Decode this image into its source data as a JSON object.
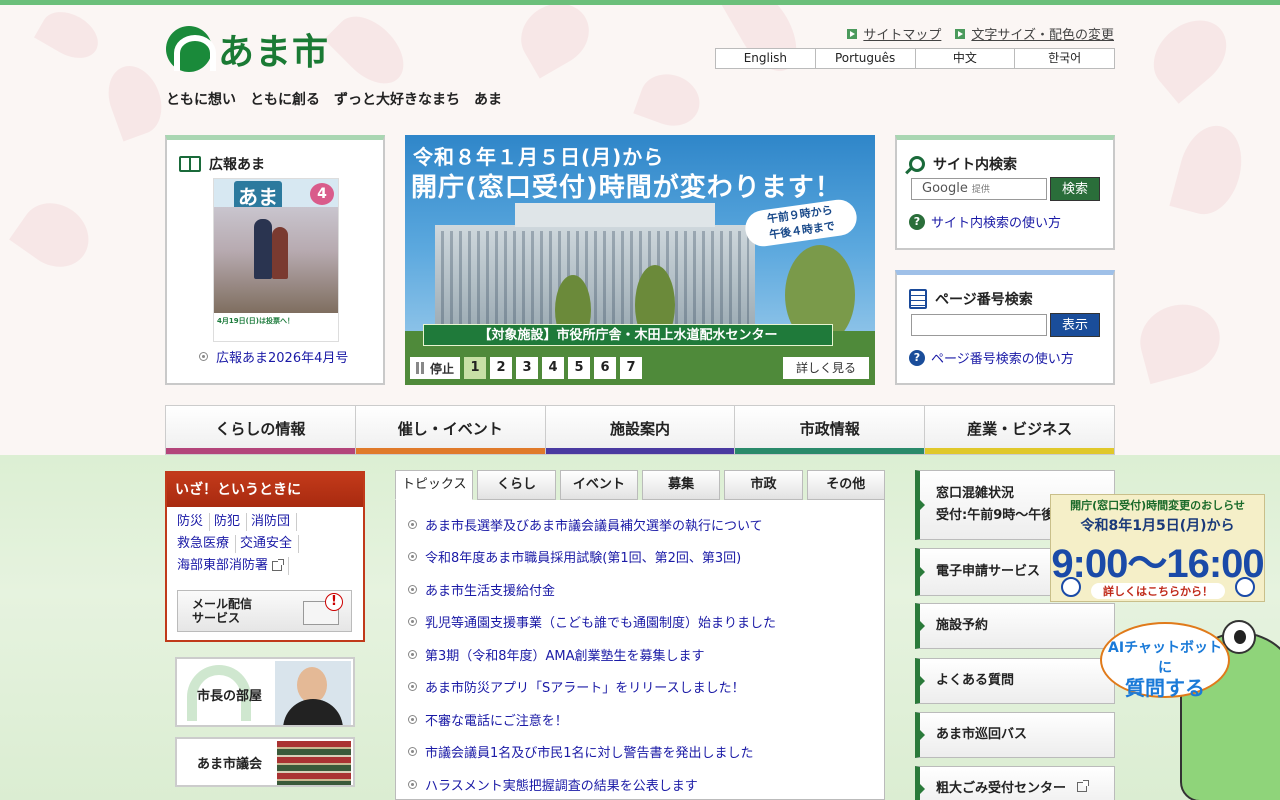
{
  "header": {
    "logo_text": "あま市",
    "tagline": "ともに想い　ともに創る　ずっと大好きなまち　あま",
    "util_links": [
      "サイトマップ",
      "文字サイズ・配色の変更"
    ],
    "languages": [
      "English",
      "Português",
      "中文",
      "한국어"
    ]
  },
  "koho": {
    "title": "広報あま",
    "cover_label": "広報",
    "cover_title": "あま",
    "cover_number": "4",
    "cover_notice": "4月19日(日)は投票へ！",
    "link": "広報あま2026年4月号"
  },
  "banner": {
    "line1": "令和８年１月５日(月)から",
    "line2": "開庁(窓口受付)時間が変わります！",
    "bubble_line1": "午前９時から",
    "bubble_line2": "午後４時まで",
    "tag": "【対象施設】市役所庁舎・木田上水道配水センター",
    "stop_label": "停止",
    "slides": [
      "1",
      "2",
      "3",
      "4",
      "5",
      "6",
      "7"
    ],
    "active_slide": 1,
    "more_label": "詳しく見る"
  },
  "site_search": {
    "title": "サイト内検索",
    "placeholder": "Google",
    "placeholder_suffix": "提供",
    "button": "検索",
    "help": "サイト内検索の使い方"
  },
  "page_search": {
    "title": "ページ番号検索",
    "button": "表示",
    "help": "ページ番号検索の使い方"
  },
  "global_nav": [
    {
      "label": "くらしの情報",
      "color": "#b3457a"
    },
    {
      "label": "催し・イベント",
      "color": "#e07a2a"
    },
    {
      "label": "施設案内",
      "color": "#4a3aa0"
    },
    {
      "label": "市政情報",
      "color": "#2a8a6a"
    },
    {
      "label": "産業・ビジネス",
      "color": "#e0c82a"
    }
  ],
  "emergency": {
    "title": "いざ！というときに",
    "links": [
      "防災",
      "防犯",
      "消防団",
      "救急医療",
      "交通安全",
      "海部東部消防署"
    ],
    "mail_line1": "メール配信",
    "mail_line2": "サービス"
  },
  "mayor": {
    "label": "市長の部屋"
  },
  "council": {
    "label": "あま市議会"
  },
  "tabs": [
    "トピックス",
    "くらし",
    "イベント",
    "募集",
    "市政",
    "その他"
  ],
  "topics": [
    "あま市長選挙及びあま市議会議員補欠選挙の執行について",
    "令和8年度あま市職員採用試験(第1回、第2回、第3回)",
    "あま市生活支援給付金",
    "乳児等通園支援事業（こども誰でも通園制度）始まりました",
    "第3期（令和8年度）AMA創業塾生を募集します",
    "あま市防災アプリ「Sアラート」をリリースしました！",
    "不審な電話にご注意を！",
    "市議会議員1名及び市民1名に対し警告書を発出しました",
    "ハラスメント実態把握調査の結果を公表します"
  ],
  "right_menu": [
    {
      "label": "窓口混雑状況",
      "sub": "受付:午前9時～午後"
    },
    {
      "label": "電子申請サービス"
    },
    {
      "label": "施設予約"
    },
    {
      "label": "よくある質問"
    },
    {
      "label": "あま市巡回バス"
    },
    {
      "label": "粗大ごみ受付センター"
    }
  ],
  "notice": {
    "line1": "開庁(窓口受付)時間変更のおしらせ",
    "line2": "令和8年1月5日(月)から",
    "hours": "9:00～16:00",
    "cta": "詳しくはこちらから！"
  },
  "chatbot": {
    "line1": "AIチャットボットに",
    "line2": "質問する"
  }
}
